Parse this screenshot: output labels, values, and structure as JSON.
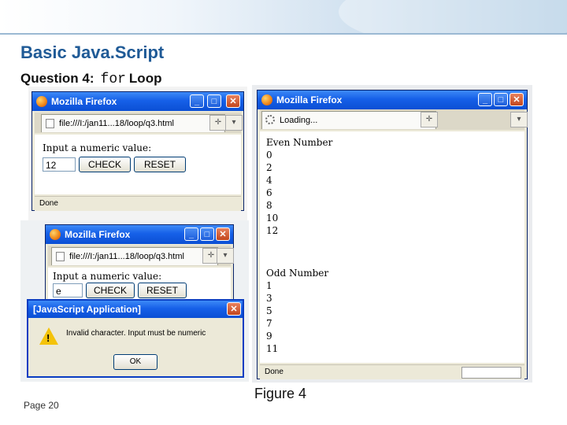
{
  "slide": {
    "title": "Basic Java.Script",
    "question_prefix": "Question 4:",
    "question_code": "for",
    "question_suffix": "Loop",
    "page_label": "Page 20",
    "figure_caption": "Figure 4"
  },
  "window1": {
    "title": "Mozilla Firefox",
    "tab_label": "file:///I:/jan11...18/loop/q3.html",
    "prompt": "Input a numeric value:",
    "input_value": "12",
    "check_label": "CHECK",
    "reset_label": "RESET",
    "status": "Done"
  },
  "window2": {
    "title": "Mozilla Firefox",
    "tab_label": "file:///I:/jan11...18/loop/q3.html",
    "prompt": "Input a numeric value:",
    "input_value": "e",
    "check_label": "CHECK",
    "reset_label": "RESET"
  },
  "dialog": {
    "title": "[JavaScript Application]",
    "message": "Invalid character. Input must be numeric",
    "ok_label": "OK"
  },
  "window3": {
    "title": "Mozilla Firefox",
    "tab_label": "Loading...",
    "even_header": "Even Number",
    "even_values": [
      "0",
      "2",
      "4",
      "6",
      "8",
      "10",
      "12"
    ],
    "odd_header": "Odd Number",
    "odd_values": [
      "1",
      "3",
      "5",
      "7",
      "9",
      "11"
    ],
    "status": "Done"
  },
  "icons": {
    "minimize": "minimize-icon",
    "maximize": "maximize-icon",
    "close": "close-icon",
    "warning": "warning-icon",
    "tab_add": "plus-icon",
    "tab_list": "chevron-down-icon"
  },
  "colors": {
    "title_blue": "#1f5a96",
    "titlebar_blue": "#1660e8",
    "window_face": "#ece9d8"
  }
}
